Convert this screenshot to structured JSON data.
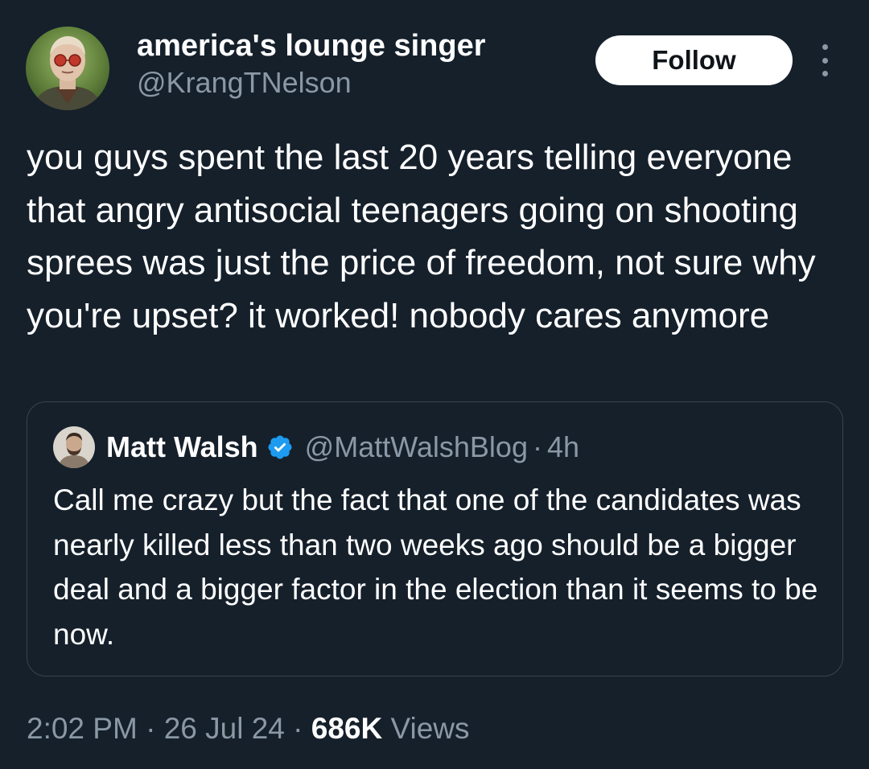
{
  "author": {
    "display_name": "america's lounge singer",
    "handle": "@KrangTNelson"
  },
  "follow_label": "Follow",
  "tweet_text": "you guys spent the last 20 years telling everyone that angry antisocial teenagers going on shooting sprees was just the price of freedom, not sure why you're upset? it worked! nobody cares anymore",
  "quoted": {
    "display_name": "Matt Walsh",
    "verified": true,
    "handle": "@MattWalshBlog",
    "separator": "·",
    "time": "4h",
    "text": "Call me crazy but the fact that one of the candidates was nearly killed less than two weeks ago should be a bigger deal and a bigger factor in the election than it seems to be now."
  },
  "meta": {
    "time": "2:02 PM",
    "date": "26 Jul 24",
    "separator": "·",
    "views_count": "686K",
    "views_label": "Views"
  },
  "colors": {
    "background": "#15202b",
    "secondary_text": "#8b98a5",
    "border": "#38444d",
    "verified_badge": "#1d9bf0",
    "follow_button_bg": "#ffffff"
  },
  "icons": {
    "more": "more-options-icon",
    "verified": "verified-badge-icon"
  }
}
